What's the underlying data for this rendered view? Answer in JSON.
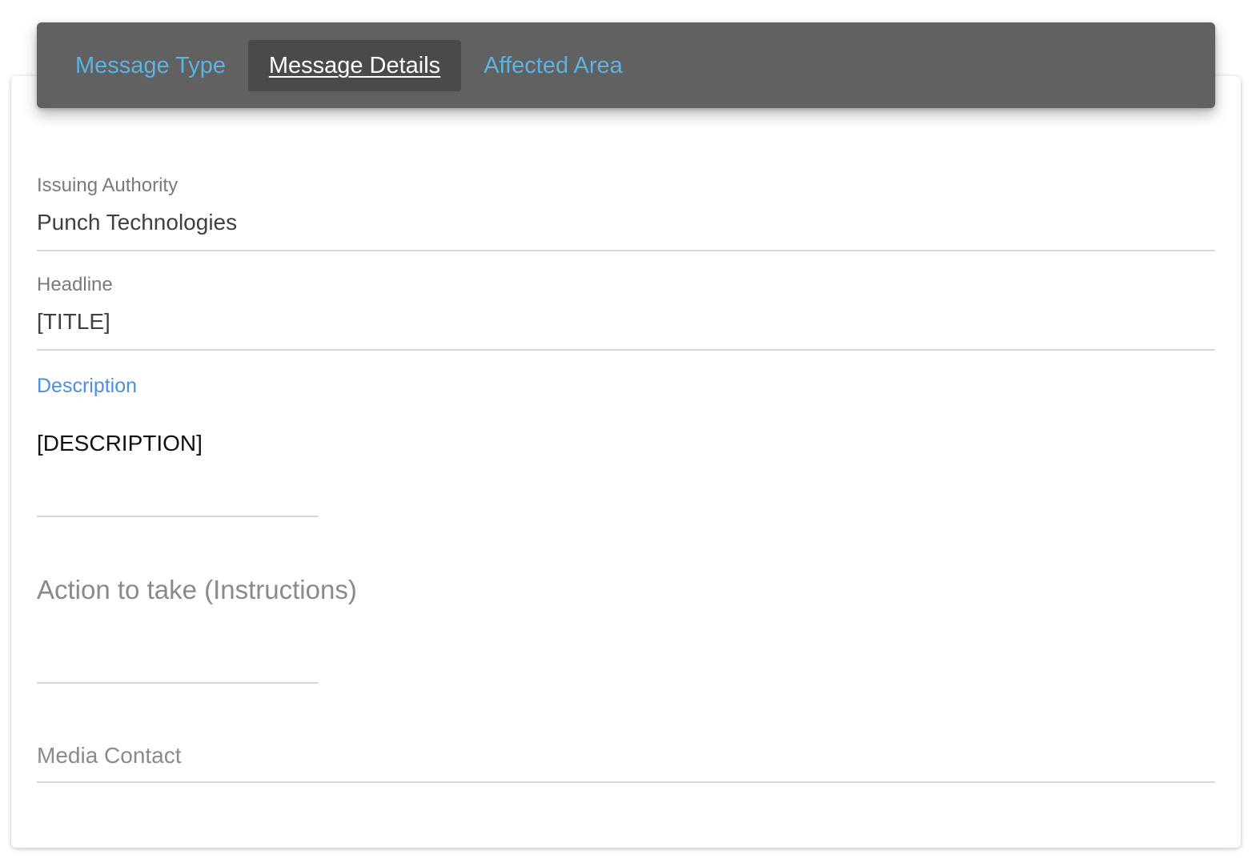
{
  "tabs": {
    "message_type": "Message Type",
    "message_details": "Message Details",
    "affected_area": "Affected Area",
    "active": "message_details"
  },
  "form": {
    "issuing_authority": {
      "label": "Issuing Authority",
      "value": "Punch Technologies"
    },
    "headline": {
      "label": "Headline",
      "value": "[TITLE]"
    },
    "description": {
      "label": "Description",
      "value": "[DESCRIPTION]"
    },
    "instructions": {
      "label": "Action to take (Instructions)",
      "value": ""
    },
    "media_contact": {
      "label": "Media Contact",
      "value": ""
    }
  },
  "colors": {
    "tabbar_bg": "#616161",
    "tab_active_bg": "#4a4a4a",
    "tab_link": "#5bb3e0",
    "focused_label": "#4a8fe0"
  }
}
